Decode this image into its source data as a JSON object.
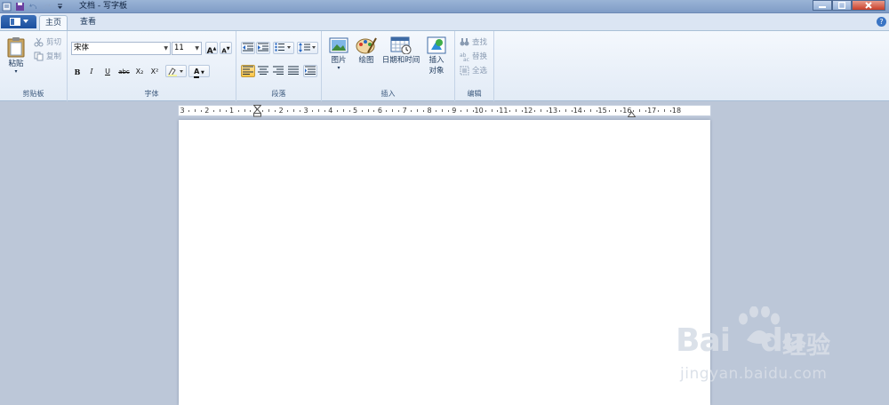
{
  "window": {
    "title": "文档 - 写字板",
    "controls": [
      "minimize",
      "maximize",
      "close"
    ]
  },
  "tabs": [
    {
      "label": "主页",
      "active": true
    },
    {
      "label": "查看",
      "active": false
    }
  ],
  "ribbon": {
    "clipboard": {
      "label": "剪贴板",
      "paste": "粘贴",
      "cut": "剪切",
      "copy": "复制"
    },
    "font": {
      "label": "字体",
      "family": "宋体",
      "size": "11",
      "bold": "B",
      "italic": "I",
      "underline": "U",
      "strike": "abc",
      "subscript": "X₂",
      "superscript": "X²",
      "grow": "A",
      "shrink": "A",
      "color_letter": "A"
    },
    "paragraph": {
      "label": "段落"
    },
    "insert": {
      "label": "插入",
      "picture": "图片",
      "paint": "绘图",
      "datetime": "日期和时间",
      "object_line1": "插入",
      "object_line2": "对象"
    },
    "editing": {
      "label": "编辑",
      "find": "查找",
      "replace": "替换",
      "select_all": "全选"
    }
  },
  "ruler": {
    "numbers": [
      "3",
      "2",
      "1",
      "1",
      "2",
      "3",
      "4",
      "5",
      "6",
      "7",
      "8",
      "9",
      "10",
      "11",
      "12",
      "13",
      "14",
      "15",
      "16",
      "17",
      "18"
    ]
  },
  "watermark": {
    "brand": "Bai",
    "brand2": "du",
    "cn": "经验",
    "url": "jingyan.baidu.com"
  },
  "colors": {
    "accent": "#1b4f9e",
    "ribbon_bg": "#f4f8fd",
    "workspace": "#bcc7d8"
  }
}
